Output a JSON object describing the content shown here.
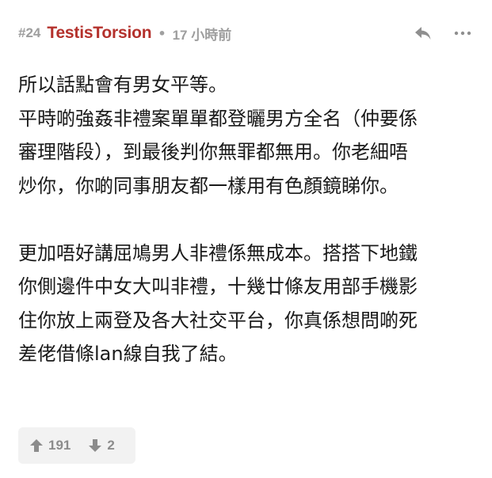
{
  "post": {
    "floor": "#24",
    "username": "TestisTorsion",
    "separator": "•",
    "time": "17 小時前",
    "content_lines": [
      "所以話點會有男女平等。",
      "平時啲強姦非禮案單單都登曬男方全名（仲要係",
      "審理階段），到最後判你無罪都無用。你老細唔",
      "炒你，你啲同事朋友都一樣用有色顏鏡睇你。",
      "",
      "更加唔好講屈鳩男人非禮係無成本。搭搭下地鐵",
      "你側邊件中女大叫非禮，十幾廿條友用部手機影",
      "住你放上兩登及各大社交平台，你真係想問啲死",
      "差佬借條lan線自我了結。"
    ],
    "upvotes": "191",
    "downvotes": "2"
  },
  "icons": {
    "reply": "reply-icon",
    "more": "more-icon",
    "upvote": "arrow-up-icon",
    "downvote": "arrow-down-icon"
  },
  "colors": {
    "username": "#b4312c",
    "meta": "#9e9e9e",
    "vote_bg": "#f2f2f2"
  }
}
